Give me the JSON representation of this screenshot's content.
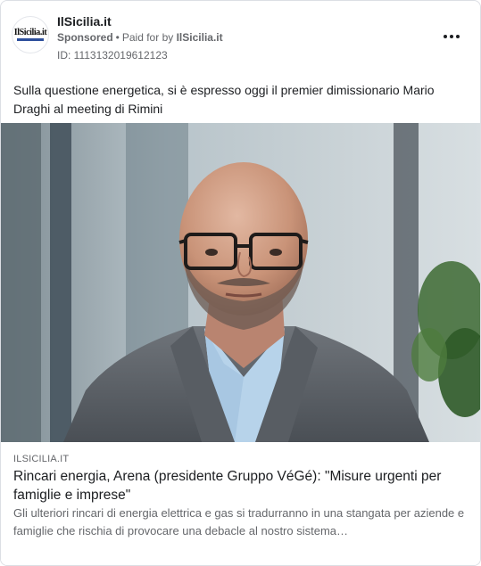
{
  "advertiser": {
    "name": "IlSicilia.it",
    "logo_text": "IlSicilia.it",
    "sponsored_label": "Sponsored",
    "paid_prefix": "Paid for by",
    "payer": "IlSicilia.it",
    "id_line": "ID: 1113132019612123"
  },
  "menu": {
    "icon": "more-horizontal-icon"
  },
  "post": {
    "text": "Sulla questione energetica, si è espresso oggi il premier dimissionario Mario Draghi al meeting di Rimini"
  },
  "media": {
    "description_icon": "portrait-photo"
  },
  "link_preview": {
    "domain": "ILSICILIA.IT",
    "headline": "Rincari energia, Arena (presidente Gruppo VéGé): \"Misure urgenti per famiglie e imprese\"",
    "description": "Gli ulteriori rincari di energia elettrica e gas si tradurranno in una stangata per aziende e famiglie che rischia di provocare una debacle al nostro sistema…"
  },
  "colors": {
    "text_primary": "#1c1e21",
    "text_secondary": "#65676b",
    "border": "#dcdfe4",
    "logo_accent": "#2d4f9c"
  }
}
